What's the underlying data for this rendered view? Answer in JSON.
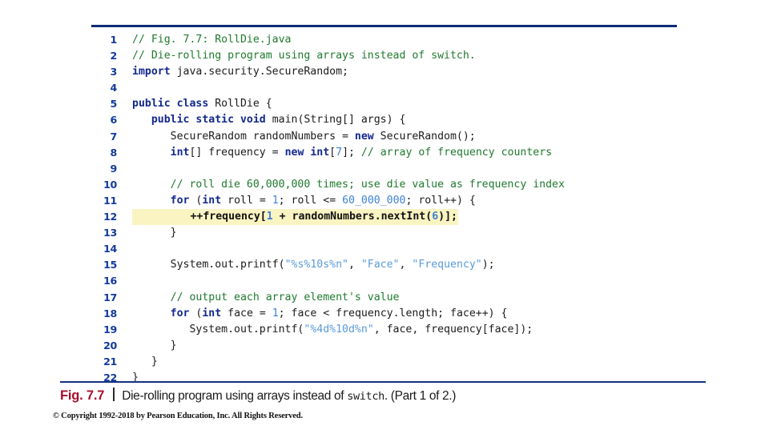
{
  "figure": {
    "top_rule_color": "#0f2b78",
    "caption_rule_color": "#14307f",
    "label": "Fig. 7.7",
    "caption": "Die-rolling program using arrays instead of ",
    "caption_mono": "switch",
    "caption_tail": ". (Part 1 of 2.)"
  },
  "copyright": "© Copyright 1992-2018 by Pearson Education, Inc. All Rights Reserved.",
  "syntax_colors": {
    "comment": "#1f7a2e",
    "keyword": "#13288f",
    "number": "#3d82d6",
    "string": "#5a9bdc",
    "plain": "#1b1b1b",
    "lineno": "#123a9c",
    "highlight_background": "#faf4c3"
  },
  "code": {
    "language": "java",
    "file": "RollDie.java",
    "first_line": 1,
    "last_line": 22,
    "highlighted_lines": [
      12
    ],
    "lines": [
      {
        "n": "1",
        "text": "// Fig. 7.7: RollDie.java"
      },
      {
        "n": "2",
        "text": "// Die-rolling program using arrays instead of switch."
      },
      {
        "n": "3",
        "text": "import java.security.SecureRandom;"
      },
      {
        "n": "4",
        "text": ""
      },
      {
        "n": "5",
        "text": "public class RollDie {"
      },
      {
        "n": "6",
        "text": "   public static void main(String[] args) {"
      },
      {
        "n": "7",
        "text": "      SecureRandom randomNumbers = new SecureRandom();"
      },
      {
        "n": "8",
        "text": "      int[] frequency = new int[7]; // array of frequency counters"
      },
      {
        "n": "9",
        "text": ""
      },
      {
        "n": "10",
        "text": "      // roll die 60,000,000 times; use die value as frequency index"
      },
      {
        "n": "11",
        "text": "      for (int roll = 1; roll <= 60_000_000; roll++) {"
      },
      {
        "n": "12",
        "text": "         ++frequency[1 + randomNumbers.nextInt(6)];"
      },
      {
        "n": "13",
        "text": "      }"
      },
      {
        "n": "14",
        "text": ""
      },
      {
        "n": "15",
        "text": "      System.out.printf(\"%s%10s%n\", \"Face\", \"Frequency\");"
      },
      {
        "n": "16",
        "text": ""
      },
      {
        "n": "17",
        "text": "      // output each array element's value"
      },
      {
        "n": "18",
        "text": "      for (int face = 1; face < frequency.length; face++) {"
      },
      {
        "n": "19",
        "text": "         System.out.printf(\"%4d%10d%n\", face, frequency[face]);"
      },
      {
        "n": "20",
        "text": "      }"
      },
      {
        "n": "21",
        "text": "   }"
      },
      {
        "n": "22",
        "text": "}"
      }
    ]
  }
}
